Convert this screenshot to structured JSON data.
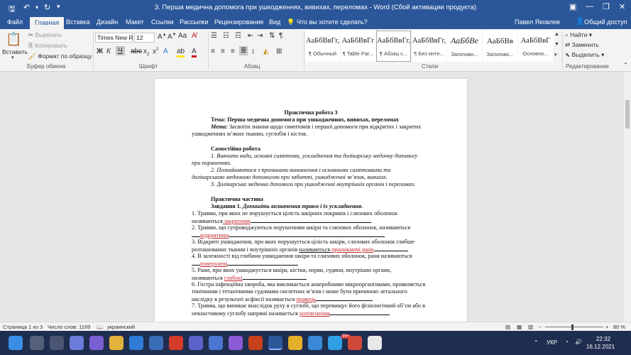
{
  "window": {
    "title": "3. Перша медична допомога при ушкодженнях, вивихах, переломах - Word (Сбой активации продукта)"
  },
  "tabs": [
    "Файл",
    "Главная",
    "Вставка",
    "Дизайн",
    "Макет",
    "Ссылки",
    "Рассылки",
    "Рецензирование",
    "Вид"
  ],
  "tell_me": "Что вы хотите сделать?",
  "user": "Павел Яковлев",
  "share": "Общий доступ",
  "clipboard": {
    "paste": "Вставить",
    "cut": "Вырезать",
    "copy": "Копировать",
    "painter": "Формат по образцу",
    "label": "Буфер обмена"
  },
  "font": {
    "name": "Times New R",
    "size": "12",
    "label": "Шрифт"
  },
  "paragraph": {
    "label": "Абзац"
  },
  "styles": {
    "label": "Стили",
    "items": [
      {
        "sample": "АаБбВвГг,",
        "name": "¶ Обычный"
      },
      {
        "sample": "АаБбВвГг",
        "name": "¶ Table Par..."
      },
      {
        "sample": "АаБбВвГг,",
        "name": "¶ Абзац с..."
      },
      {
        "sample": "АаБбВвГг,",
        "name": "¶ Без инте..."
      },
      {
        "sample": "АаБбВе",
        "name": "Заголово..."
      },
      {
        "sample": "АаБбВв",
        "name": "Заголово..."
      },
      {
        "sample": "АаБбВвГ",
        "name": "Основно..."
      }
    ]
  },
  "editing": {
    "find": "Найти",
    "replace": "Заменить",
    "select": "Выделить",
    "label": "Редактирование"
  },
  "document": {
    "l1": "Практична робота 3",
    "l2": "Тема: Перша медична допомога при ушкодженнях, вивихах, переломах",
    "l3a": "Мета:",
    "l3b": " Засвоїти знання щодо симптомів і першої допомоги при відкритих і закритих",
    "l4": "ушкодженнях м’яких тканин, суглобів і кісток.",
    "l5": "Самостійна робота",
    "l6": "1.      Вивчити види, основні симптоми, ускладнення та долікарську медичну допомогу",
    "l7": "при пораненнях.",
    "l8": "2.      Познайомитися з причинами виникнення і основними симптомами та",
    "l9": "долікарською медичною допомогою при забитті, ушкодженні зв’язок, вивихах.",
    "l10": "3.      Долікарська медична допомога при ушкодженні внутрішніх органів і переломах.",
    "l11": "Практична частина",
    "l12a": "Завдання 1.",
    "l12b": " Допишіть визначення травм і їх ускладнення",
    "l12c": ".",
    "l13": "1.      Травми, при яких не порушується цілість шкірних покривів і слизових оболонок",
    "l14a": "називаються",
    "l14b": "   закритими",
    "l15": "2.      Травми, що супроводжуються порушенням шкіри та слизових оболонок, називаються",
    "l16a": "",
    "l16b": "відкритими",
    "l17": "3.      Відкриті ушкодження, при яких порушується цілість шкіри, слизових оболонок глибше",
    "l18a": "розташованих тканин і внутрішніх органів ",
    "l18b": "називаються",
    "l18c": " проникаючі",
    "l18d": "   рани",
    "l19": "4.      В залежності від глибини ушкодження шкіри та слизових оболонок, рани називаються",
    "l20a": "",
    "l20b": "поверхневі",
    "l21": "5.      Рани, при яких ушкоджується шкіра, кістки, нерви, судини, внутрішні органи,",
    "l22a": "називаються ",
    "l22b": "глибокі",
    "l23": "6. Гостра інфекційна хвороба, яка викликається анаеробними мікроорганізмами, проявляється",
    "l24": "тонічними і тетанічними судомами скелетних м’язів і може бути причиною летального",
    "l25a": "наслідку в результаті асфіксії називається ",
    "l25b": " правець",
    "l26": "7. Травма, що виникає внаслідок руху в суглобі, що перевищує його фізіологічний об’єм або в",
    "l27a": "невластивому суглобу напрямі називається ",
    "l27b": "  розтягнення"
  },
  "status": {
    "page": "Страница 1 из 3",
    "words": "Число слов: 1169",
    "lang": "украинский",
    "zoom": "80 %"
  },
  "taskbar": {
    "lang": "УКР",
    "time": "22:32",
    "date": "16.12.2021",
    "badge": "99+"
  }
}
